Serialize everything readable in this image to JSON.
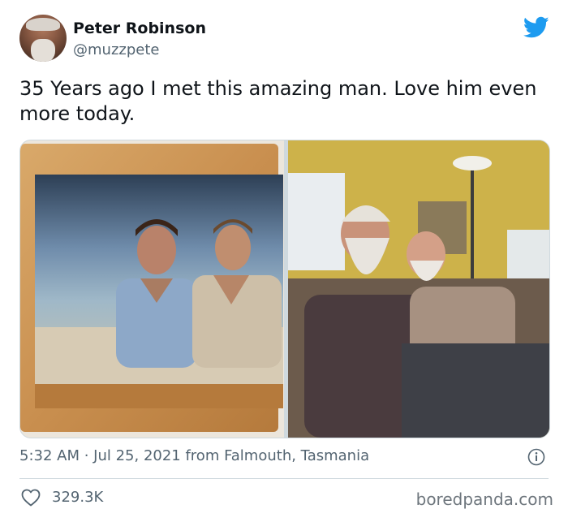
{
  "user": {
    "display_name": "Peter Robinson",
    "handle": "@muzzpete"
  },
  "tweet": {
    "text": "35 Years ago I met this amazing man. Love him even more today.",
    "timestamp": "5:32 AM · Jul 25, 2021 from Falmouth, Tasmania",
    "likes": "329.3K"
  },
  "watermark": "boredpanda.com",
  "icons": {
    "brand": "twitter-bird-icon",
    "info": "info-icon",
    "like": "heart-icon"
  },
  "colors": {
    "twitter_blue": "#1d9bf0",
    "text_secondary": "#536471"
  }
}
